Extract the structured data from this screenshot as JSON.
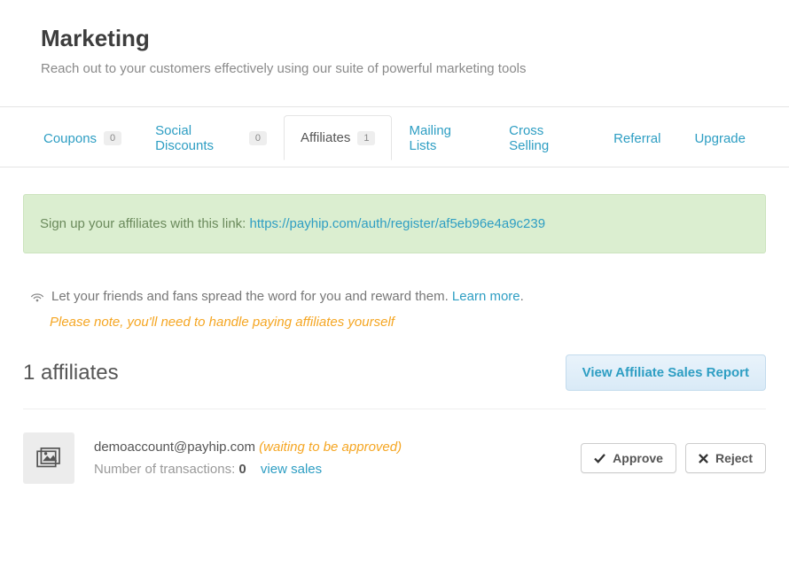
{
  "header": {
    "title": "Marketing",
    "subtitle": "Reach out to your customers effectively using our suite of powerful marketing tools"
  },
  "tabs": [
    {
      "label": "Coupons",
      "badge": "0"
    },
    {
      "label": "Social Discounts",
      "badge": "0"
    },
    {
      "label": "Affiliates",
      "badge": "1"
    },
    {
      "label": "Mailing Lists"
    },
    {
      "label": "Cross Selling"
    },
    {
      "label": "Referral"
    },
    {
      "label": "Upgrade"
    }
  ],
  "alert": {
    "prefix": "Sign up your affiliates with this link: ",
    "link": "https://payhip.com/auth/register/af5eb96e4a9c239"
  },
  "info": {
    "text_before": "Let your friends and fans spread the word for you and reward them. ",
    "learn_more": "Learn more",
    "text_after": "."
  },
  "note": "Please note, you'll need to handle paying affiliates yourself",
  "list_heading": "1 affiliates",
  "report_button": "View Affiliate Sales Report",
  "affiliate": {
    "email": "demoaccount@payhip.com",
    "status": "(waiting to be approved)",
    "tx_label": "Number of transactions: ",
    "tx_count": "0",
    "view_sales": "view sales"
  },
  "buttons": {
    "approve": "Approve",
    "reject": "Reject"
  }
}
